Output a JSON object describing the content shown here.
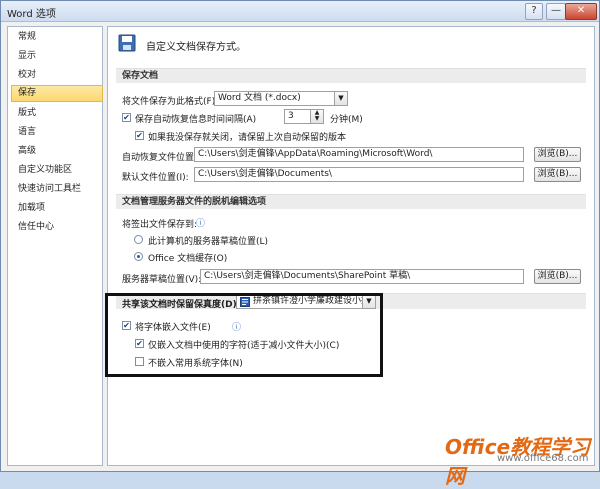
{
  "window": {
    "title": "Word 选项",
    "help": "?",
    "minimize": "—",
    "close": "✕"
  },
  "sidebar": {
    "items": [
      {
        "label": "常规"
      },
      {
        "label": "显示"
      },
      {
        "label": "校对"
      },
      {
        "label": "保存",
        "selected": true
      },
      {
        "label": "版式"
      },
      {
        "label": "语言"
      },
      {
        "label": "高级"
      },
      {
        "label": "自定义功能区"
      },
      {
        "label": "快速访问工具栏"
      },
      {
        "label": "加载项"
      },
      {
        "label": "信任中心"
      }
    ]
  },
  "header": {
    "title": "自定义文档保存方式。",
    "icon": "save-icon"
  },
  "save_docs": {
    "section_title": "保存文档",
    "format_label": "将文件保存为此格式(F):",
    "format_value": "Word 文档 (*.docx)",
    "autorecover_label": "保存自动恢复信息时间间隔(A)",
    "autorecover_checked": true,
    "autorecover_minutes": "3",
    "autorecover_unit": "分钟(M)",
    "keep_last_label": "如果我没保存就关闭，请保留上次自动保留的版本",
    "keep_last_checked": true,
    "autorecover_path_label": "自动恢复文件位置(R):",
    "autorecover_path": "C:\\Users\\剑走偏锋\\AppData\\Roaming\\Microsoft\\Word\\",
    "default_path_label": "默认文件位置(I):",
    "default_path": "C:\\Users\\剑走偏锋\\Documents\\",
    "browse1": "浏览(B)...",
    "browse2": "浏览(B)..."
  },
  "offline": {
    "section_title": "文档管理服务器文件的脱机编辑选项",
    "checkout_label": "将签出文件保存到:",
    "info_glyph": "ⓘ",
    "opt_server": "此计算机的服务器草稿位置(L)",
    "opt_server_checked": false,
    "opt_cache": "Office 文档缓存(O)",
    "opt_cache_checked": true,
    "drafts_label": "服务器草稿位置(V):",
    "drafts_path": "C:\\Users\\剑走偏锋\\Documents\\SharePoint 草稿\\",
    "browse3": "浏览(B)..."
  },
  "fidelity": {
    "label": "共享该文档时保留保真度(D):",
    "doc_name": "拼茶镇许澄小学廉政建设小报",
    "embed_fonts_label": "将字体嵌入文件(E)",
    "embed_fonts_checked": true,
    "embed_used_label": "仅嵌入文档中使用的字符(适于减小文件大小)(C)",
    "embed_used_checked": true,
    "no_common_label": "不嵌入常用系统字体(N)",
    "no_common_checked": false
  },
  "watermark": {
    "brand": "Office教程学习网",
    "url": "www.office68.com"
  },
  "colors": {
    "accent": "#fbd870",
    "watermark": "#e36a14",
    "highlight": "#111111"
  }
}
